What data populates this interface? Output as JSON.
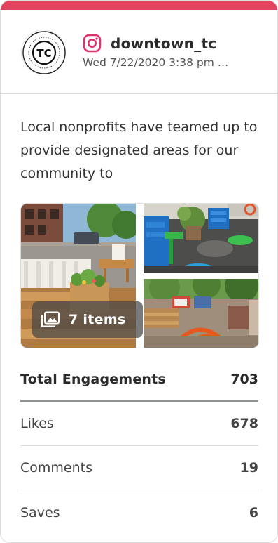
{
  "post": {
    "account": {
      "username": "downtown_tc",
      "platform_icon": "instagram-icon",
      "avatar_text": "TC",
      "avatar_ring_text": "DOWNTOWN · TRAVERSE CITY"
    },
    "timestamp": "Wed 7/22/2020 3:38 pm …",
    "caption": "Local nonprofits have teamed up to provide designated areas for our community to",
    "media": {
      "items_label": "7 items",
      "items_icon": "gallery-icon"
    }
  },
  "stats": {
    "total": {
      "label": "Total Engagements",
      "value": "703"
    },
    "rows": [
      {
        "label": "Likes",
        "value": "678"
      },
      {
        "label": "Comments",
        "value": "19"
      },
      {
        "label": "Saves",
        "value": "6"
      }
    ]
  },
  "colors": {
    "accent": "#e0445e",
    "instagram": "#e1306c",
    "divider": "#8f9393"
  }
}
